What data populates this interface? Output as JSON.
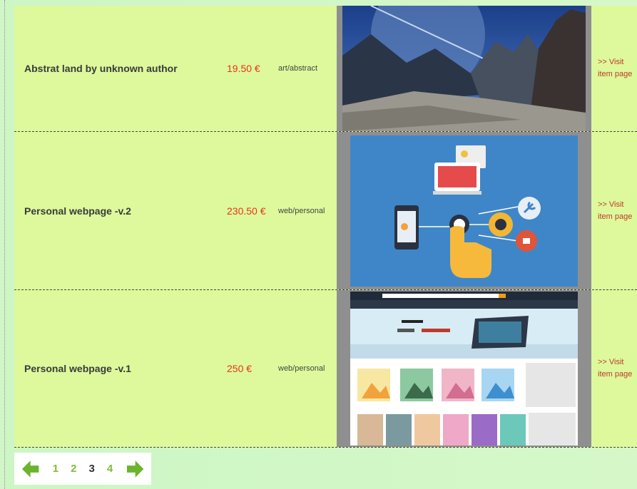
{
  "items": [
    {
      "title": "Abstrat land by unknown author",
      "price": "19.50 €",
      "category": "art/abstract",
      "image_icon": "mountain-landscape-image",
      "link": ">> Visit item page"
    },
    {
      "title": "Personal webpage -v.2",
      "price": "230.50 €",
      "category": "web/personal",
      "image_icon": "web-design-illustration-image",
      "link": ">> Visit item page"
    },
    {
      "title": "Personal webpage -v.1",
      "price": "250 €",
      "category": "web/personal",
      "image_icon": "shop-webpage-screenshot-image",
      "link": ">> Visit item page"
    }
  ],
  "pagination": {
    "pages": [
      "1",
      "2",
      "3",
      "4"
    ],
    "current": "3",
    "prev_icon": "left-arrow-icon",
    "next_icon": "right-arrow-icon"
  },
  "colors": {
    "row_bg": "#ddf99c",
    "price": "#e8341c",
    "link": "#c0392b",
    "page_link": "#7cbf3a",
    "arrow": "#6ab42e"
  }
}
